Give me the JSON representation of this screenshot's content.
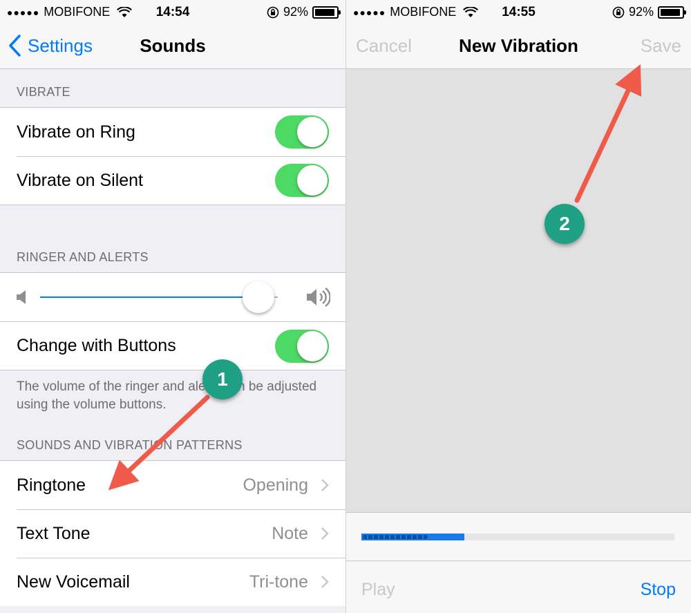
{
  "left": {
    "status": {
      "signal": "●●●●●",
      "carrier": "MOBIFONE",
      "time": "14:54",
      "battery": "92%"
    },
    "nav": {
      "back_label": "Settings",
      "title": "Sounds"
    },
    "vibrate": {
      "header": "VIBRATE",
      "rows": [
        {
          "label": "Vibrate on Ring",
          "on": true
        },
        {
          "label": "Vibrate on Silent",
          "on": true
        }
      ]
    },
    "ringer": {
      "header": "RINGER AND ALERTS",
      "volume_fraction": 0.92,
      "change_with_buttons": "Change with Buttons",
      "footer": "The volume of the ringer and alerts can be adjusted using the volume buttons."
    },
    "patterns": {
      "header": "SOUNDS AND VIBRATION PATTERNS",
      "rows": [
        {
          "label": "Ringtone",
          "value": "Opening"
        },
        {
          "label": "Text Tone",
          "value": "Note"
        },
        {
          "label": "New Voicemail",
          "value": "Tri-tone"
        }
      ]
    }
  },
  "right": {
    "status": {
      "signal": "●●●●●",
      "carrier": "MOBIFONE",
      "time": "14:55",
      "battery": "92%"
    },
    "nav": {
      "cancel_label": "Cancel",
      "title": "New Vibration",
      "save_label": "Save"
    },
    "progress_fraction": 0.33,
    "play_label": "Play",
    "stop_label": "Stop"
  },
  "annotations": {
    "badge_1": "1",
    "badge_2": "2"
  },
  "colors": {
    "accent": "#007aff",
    "toggle_on": "#4cd964",
    "badge": "#1fa084",
    "arrow": "#ef5a4a"
  }
}
